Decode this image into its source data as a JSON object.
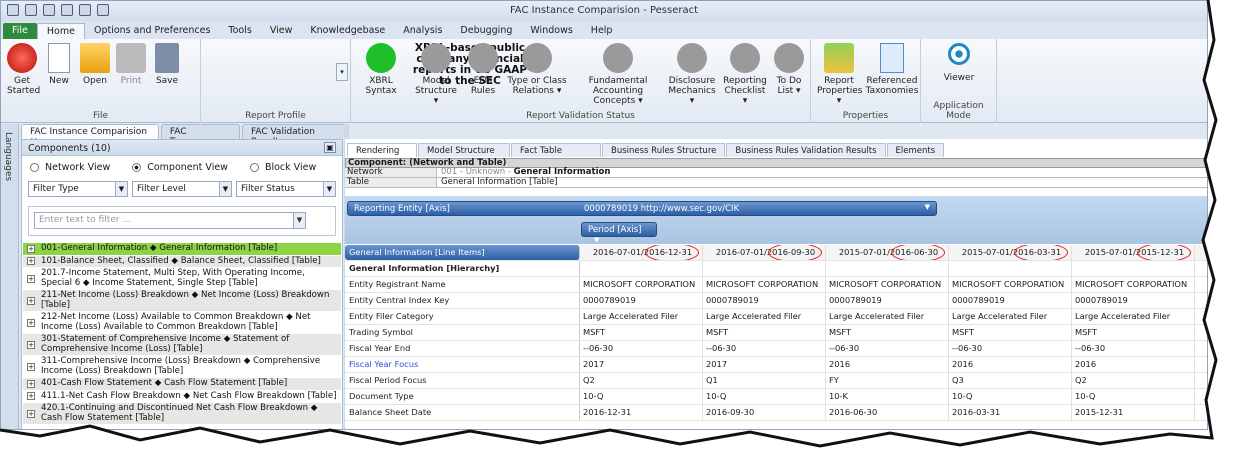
{
  "window": {
    "title": "FAC Instance Comparision - Pesseract"
  },
  "ribbon_tabs": [
    "File",
    "Home",
    "Options and Preferences",
    "Tools",
    "View",
    "Knowledgebase",
    "Analysis",
    "Debugging",
    "Windows",
    "Help"
  ],
  "file_group": {
    "label": "File",
    "buttons": [
      "Get Started",
      "New",
      "Open",
      "Print",
      "Save"
    ]
  },
  "report_profile": {
    "label": "Report Profile",
    "text": "XBRL-based public company financial reports in US GAAP to the SEC"
  },
  "validation_group": {
    "label": "Report Validation Status",
    "buttons": [
      "XBRL Syntax",
      "Model Structure ▾",
      "EFM Rules",
      "Type or Class Relations ▾",
      "Fundamental Accounting Concepts ▾",
      "Disclosure Mechanics ▾",
      "Reporting Checklist ▾",
      "To Do List ▾"
    ]
  },
  "properties_group": {
    "label": "Properties",
    "buttons": [
      "Report Properties ▾",
      "Referenced Taxonomies"
    ]
  },
  "app_mode_group": {
    "label": "Application Mode",
    "buttons": [
      "Viewer"
    ]
  },
  "left_bar": {
    "label": "Languages"
  },
  "doc_tabs": [
    "FAC Instance Comparision",
    "FAC Taxonomy",
    "FAC Validation Result"
  ],
  "components": {
    "header": "Components (10)",
    "views": [
      "Network View",
      "Component View",
      "Block View"
    ],
    "filters": [
      "Filter Type",
      "Filter Level",
      "Filter Status"
    ],
    "search_placeholder": "Enter text to filter ...",
    "items": [
      "001-General Information ◆ General Information [Table]",
      "101-Balance Sheet, Classified ◆ Balance Sheet, Classified [Table]",
      "201.7-Income Statement, Multi Step, With Operating Income, Special 6 ◆ Income Statement, Single Step [Table]",
      "211-Net Income (Loss) Breakdown ◆ Net Income (Loss) Breakdown [Table]",
      "212-Net Income (Loss) Available to Common Breakdown ◆ Net Income (Loss) Available to Common Breakdown [Table]",
      "301-Statement of Comprehensive Income ◆ Statement of Comprehensive Income (Loss) [Table]",
      "311-Comprehensive Income (Loss) Breakdown ◆ Comprehensive Income (Loss) Breakdown [Table]",
      "401-Cash Flow Statement ◆ Cash Flow Statement [Table]",
      "411.1-Net Cash Flow Breakdown ◆ Net Cash Flow Breakdown [Table]",
      "420.1-Continuing and Discontinued Net Cash Flow Breakdown ◆ Cash Flow Statement [Table]"
    ]
  },
  "render_tabs": [
    "Rendering",
    "Model Structure",
    "Fact Table",
    "Business Rules Structure",
    "Business Rules Validation Results",
    "Elements"
  ],
  "component_header": {
    "title": "Component: (Network and Table)",
    "network_label": "Network",
    "network_prefix": "001 - Unknown - ",
    "network_value": "General Information",
    "table_label": "Table",
    "table_value": "General Information [Table]"
  },
  "axis": {
    "entity_label": "Reporting Entity [Axis]",
    "entity_value": "0000789019 http://www.sec.gov/CIK",
    "period_label": "Period [Axis]"
  },
  "grid": {
    "line_items": "General Information [Line Items]",
    "columns": [
      "2016-07-01/2016-12-31",
      "2016-07-01/2016-09-30",
      "2015-07-01/2016-06-30",
      "2015-07-01/2016-03-31",
      "2015-07-01/2015-12-31"
    ],
    "hierarchy": "General Information [Hierarchy]",
    "rows": [
      {
        "label": "Entity Registrant Name",
        "values": [
          "MICROSOFT CORPORATION",
          "MICROSOFT CORPORATION",
          "MICROSOFT CORPORATION",
          "MICROSOFT CORPORATION",
          "MICROSOFT CORPORATION"
        ]
      },
      {
        "label": "Entity Central Index Key",
        "values": [
          "0000789019",
          "0000789019",
          "0000789019",
          "0000789019",
          "0000789019"
        ]
      },
      {
        "label": "Entity Filer Category",
        "values": [
          "Large Accelerated Filer",
          "Large Accelerated Filer",
          "Large Accelerated Filer",
          "Large Accelerated Filer",
          "Large Accelerated Filer"
        ]
      },
      {
        "label": "Trading Symbol",
        "values": [
          "MSFT",
          "MSFT",
          "MSFT",
          "MSFT",
          "MSFT"
        ]
      },
      {
        "label": "Fiscal Year End",
        "values": [
          "--06-30",
          "--06-30",
          "--06-30",
          "--06-30",
          "--06-30"
        ]
      },
      {
        "label": "Fiscal Year Focus",
        "values": [
          "2017",
          "2017",
          "2016",
          "2016",
          "2016"
        ]
      },
      {
        "label": "Fiscal Period Focus",
        "values": [
          "Q2",
          "Q1",
          "FY",
          "Q3",
          "Q2"
        ]
      },
      {
        "label": "Document Type",
        "values": [
          "10-Q",
          "10-Q",
          "10-K",
          "10-Q",
          "10-Q"
        ]
      },
      {
        "label": "Balance Sheet Date",
        "values": [
          "2016-12-31",
          "2016-09-30",
          "2016-06-30",
          "2016-03-31",
          "2015-12-31"
        ]
      }
    ]
  },
  "colors": {
    "accent": "#2e8b3d",
    "selected_row": "#8dd346",
    "highlight_oval": "#e02020"
  }
}
